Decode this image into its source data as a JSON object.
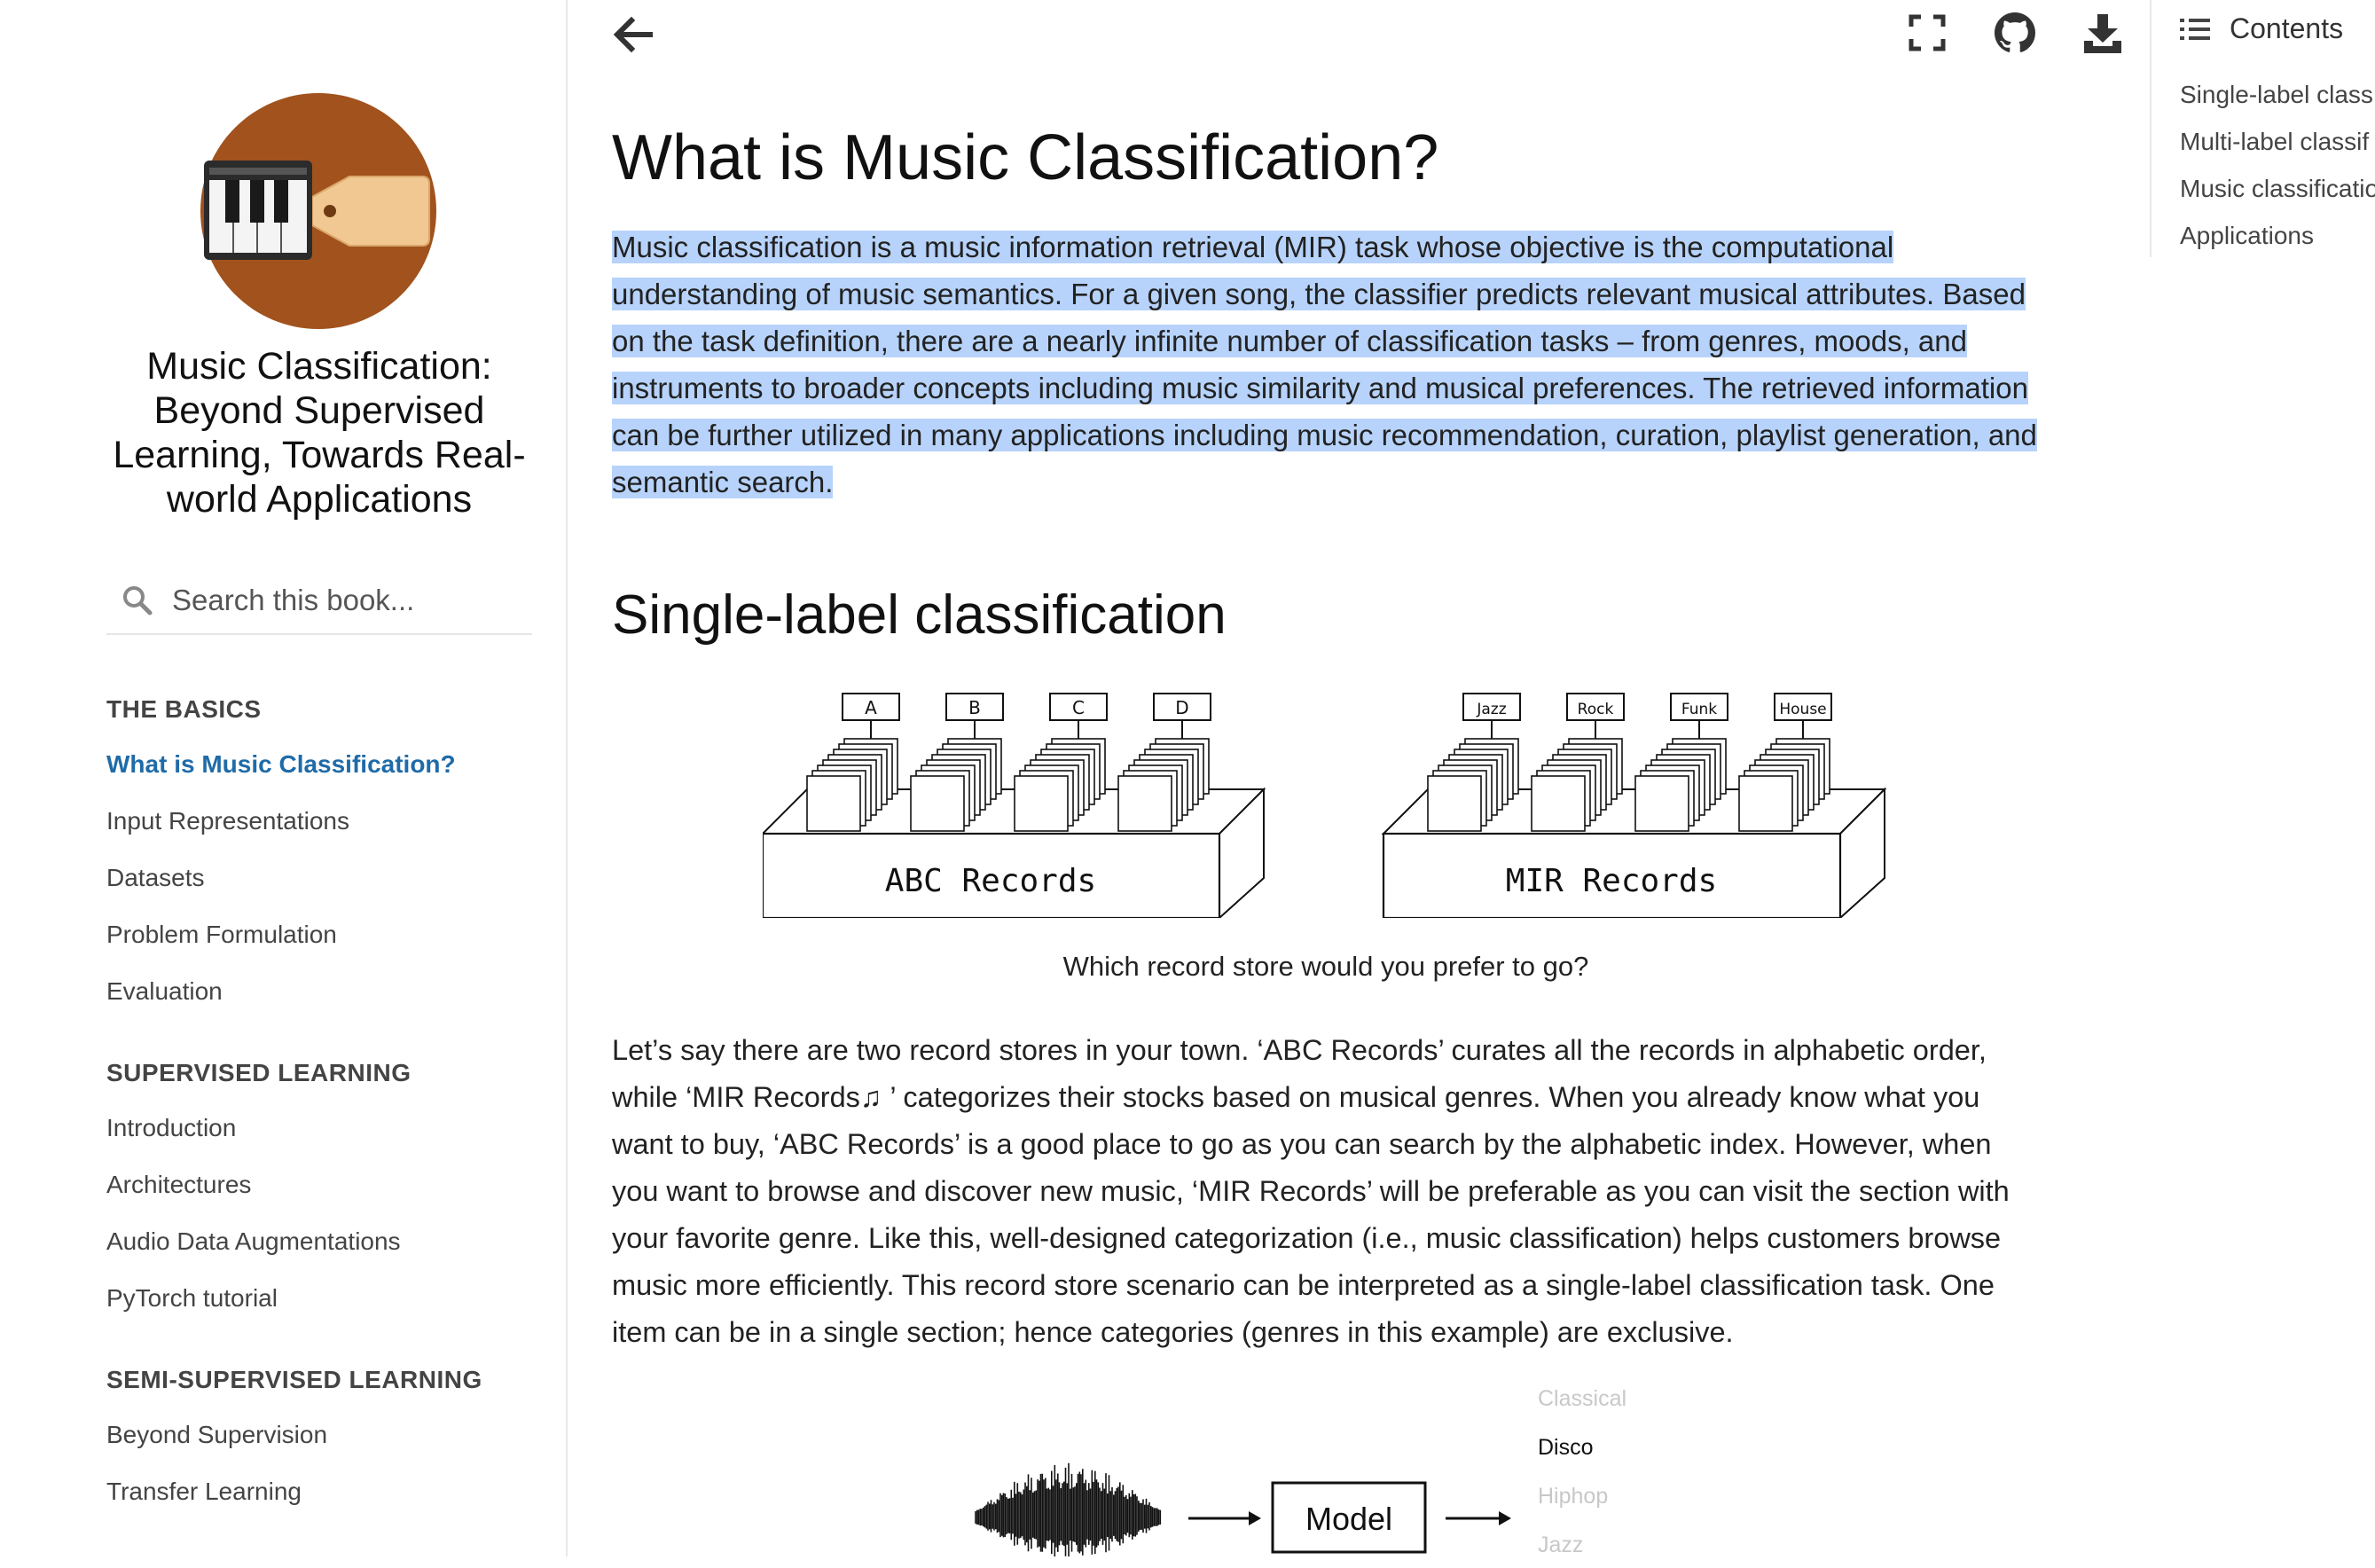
{
  "sidebar": {
    "book_title": "Music Classification: Beyond Supervised Learning, Towards Real-world Applications",
    "search_placeholder": "Search this book...",
    "sections": [
      {
        "caption": "THE BASICS",
        "items": [
          "What is Music Classification?",
          "Input Representations",
          "Datasets",
          "Problem Formulation",
          "Evaluation"
        ]
      },
      {
        "caption": "SUPERVISED LEARNING",
        "items": [
          "Introduction",
          "Architectures",
          "Audio Data Augmentations",
          "PyTorch tutorial"
        ]
      },
      {
        "caption": "SEMI-SUPERVISED LEARNING",
        "items": [
          "Beyond Supervision",
          "Transfer Learning"
        ]
      }
    ],
    "active_item": "What is Music Classification?"
  },
  "toolbar": {
    "icons": [
      "arrow-left-icon",
      "fullscreen-icon",
      "github-icon",
      "download-icon"
    ]
  },
  "toc": {
    "title": "Contents",
    "items": [
      "Single-label class",
      "Multi-label classif",
      "Music classificatio",
      "Applications"
    ]
  },
  "main": {
    "title": "What is Music Classification?",
    "intro": "Music classification is a music information retrieval (MIR) task whose objective is the computational understanding of music semantics. For a given song, the classifier predicts relevant musical attributes. Based on the task definition, there are a nearly infinite number of classification tasks – from genres, moods, and instruments to broader concepts including music similarity and musical preferences. The retrieved information can be further utilized in many applications including music recommendation, curation, playlist generation, and semantic search.",
    "section_single": "Single-label classification",
    "figure_stores": {
      "left_store": "ABC Records",
      "left_labels": [
        "A",
        "B",
        "C",
        "D"
      ],
      "right_store": "MIR Records",
      "right_labels": [
        "Jazz",
        "Rock",
        "Funk",
        "House"
      ]
    },
    "figure_caption": "Which record store would you prefer to go?",
    "paragraph2": "Let’s say there are two record stores in your town. ‘ABC Records’ curates all the records in alphabetic order, while ‘MIR Records♫ ’ categorizes their stocks based on musical genres. When you already know what you want to buy, ‘ABC Records’ is a good place to go as you can search by the alphabetic index. However, when you want to browse and discover new music, ‘MIR Records’ will be preferable as you can visit the section with your favorite genre. Like this, well-designed categorization (i.e., music classification) helps customers browse music more efficiently. This record store scenario can be interpreted as a single-label classification task. One item can be in a single section; hence categories (genres in this example) are exclusive.",
    "figure_model": {
      "model_label": "Model",
      "genres": [
        "Classical",
        "Disco",
        "Hiphop",
        "Jazz"
      ],
      "highlighted": "Disco"
    }
  },
  "colors": {
    "accent": "#1f6ba8",
    "selection": "#b7d3fb",
    "logo_circle": "#a1521d"
  }
}
